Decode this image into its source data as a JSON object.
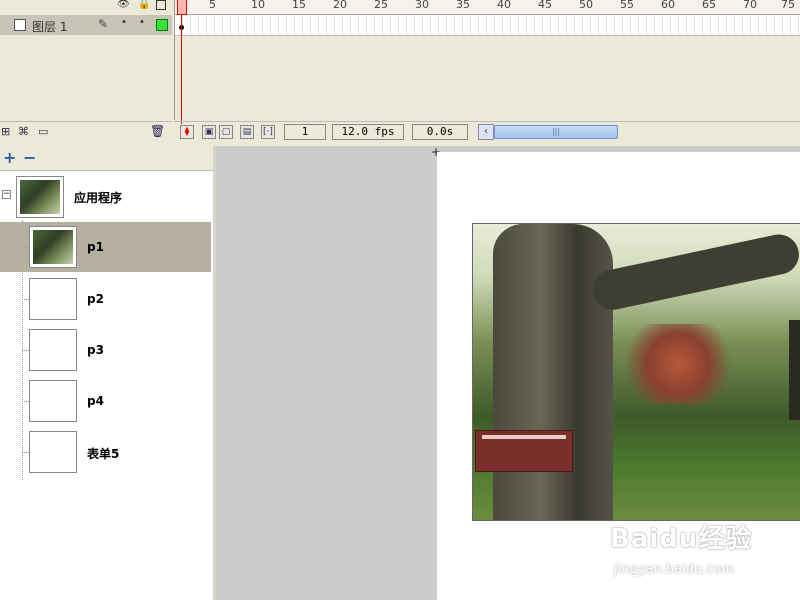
{
  "timeline": {
    "header_icons": [
      "eye-icon",
      "lock-icon",
      "outline-icon"
    ],
    "layer": {
      "name": "图层 1",
      "color": "#3ddc3d"
    },
    "ruler_ticks": [
      "1",
      "5",
      "10",
      "15",
      "20",
      "25",
      "30",
      "35",
      "40",
      "45",
      "50",
      "55",
      "60",
      "65",
      "70",
      "75"
    ],
    "current_frame": "1",
    "frame_rate": "12.0 fps",
    "elapsed_time": "0.0s"
  },
  "outline": {
    "root_label": "应用程序",
    "screens": [
      {
        "label": "p1",
        "selected": true
      },
      {
        "label": "p2",
        "selected": false
      },
      {
        "label": "p3",
        "selected": false
      },
      {
        "label": "p4",
        "selected": false
      },
      {
        "label": "表单5",
        "selected": false
      }
    ]
  },
  "watermark": {
    "logo": "Baidu经验",
    "url": "jingyan.baidu.com"
  },
  "colors": {
    "playhead": "#e00000",
    "selection": "#b5b0a0",
    "stage_bg": "#cccccc"
  }
}
